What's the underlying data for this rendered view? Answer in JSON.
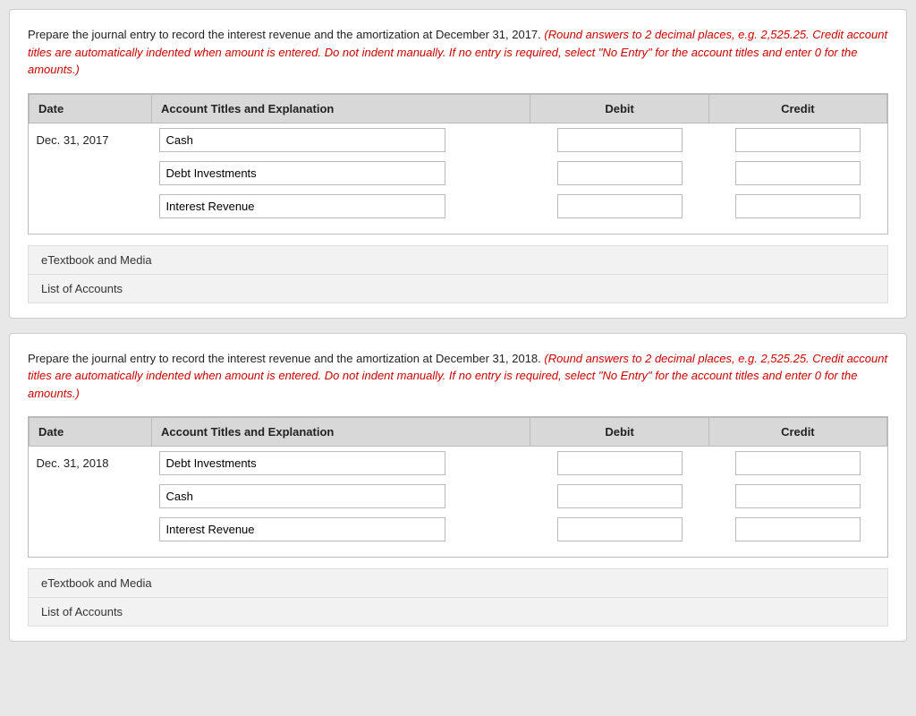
{
  "card1": {
    "instruction_plain": "Prepare the journal entry to record the interest revenue and the amortization at December 31, 2017. ",
    "instruction_red": "(Round answers to 2 decimal places, e.g. 2,525.25. Credit account titles are automatically indented when amount is entered. Do not indent manually. If no entry is required, select \"No Entry\" for the account titles and enter 0 for the amounts.)",
    "table": {
      "headers": [
        "Date",
        "Account Titles and Explanation",
        "Debit",
        "Credit"
      ],
      "date": "Dec. 31, 2017",
      "rows": [
        {
          "account": "Cash",
          "debit": "",
          "credit": ""
        },
        {
          "account": "Debt Investments",
          "debit": "",
          "credit": ""
        },
        {
          "account": "Interest Revenue",
          "debit": "",
          "credit": ""
        }
      ]
    },
    "footer1": "eTextbook and Media",
    "footer2": "List of Accounts"
  },
  "card2": {
    "instruction_plain": "Prepare the journal entry to record the interest revenue and the amortization at December 31, 2018. ",
    "instruction_red": "(Round answers to 2 decimal places, e.g. 2,525.25. Credit account titles are automatically indented when amount is entered. Do not indent manually. If no entry is required, select \"No Entry\" for the account titles and enter 0 for the amounts.)",
    "table": {
      "headers": [
        "Date",
        "Account Titles and Explanation",
        "Debit",
        "Credit"
      ],
      "date": "Dec. 31, 2018",
      "rows": [
        {
          "account": "Debt Investments",
          "debit": "",
          "credit": ""
        },
        {
          "account": "Cash",
          "debit": "",
          "credit": ""
        },
        {
          "account": "Interest Revenue",
          "debit": "",
          "credit": ""
        }
      ]
    },
    "footer1": "eTextbook and Media",
    "footer2": "List of Accounts"
  }
}
